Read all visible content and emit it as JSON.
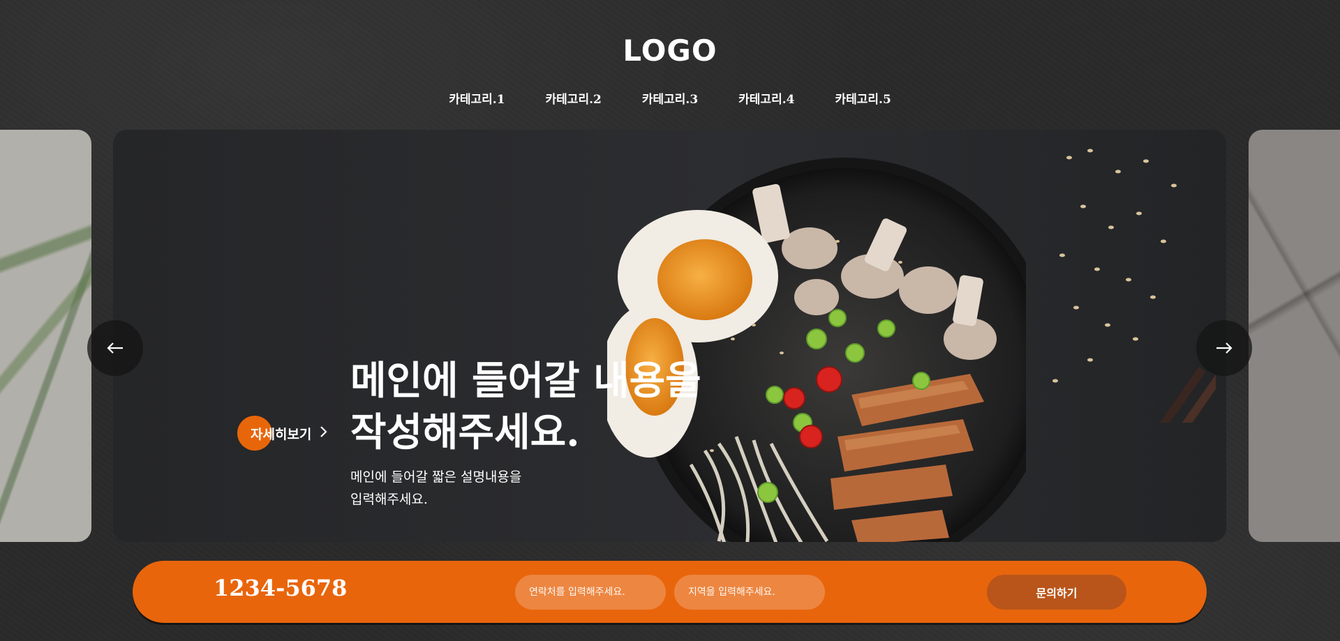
{
  "header": {
    "logo": "LOGO",
    "nav": [
      {
        "label": "카테고리.1"
      },
      {
        "label": "카테고리.2"
      },
      {
        "label": "카테고리.3"
      },
      {
        "label": "카테고리.4"
      },
      {
        "label": "카테고리.5"
      }
    ]
  },
  "hero": {
    "title_line1": "메인에 들어갈 내용을",
    "title_line2": "작성해주세요.",
    "desc_line1": "메인에 들어갈 짧은 설명내용을",
    "desc_line2": "입력해주세요.",
    "more_label": "자세히보기",
    "more_icon": "chevron-right-icon",
    "prev_icon": "arrow-left-icon",
    "next_icon": "arrow-right-icon"
  },
  "inquiry": {
    "phone": "1234-5678",
    "contact_placeholder": "연락처를 입력해주세요.",
    "region_placeholder": "지역을 입력해주세요.",
    "submit_label": "문의하기"
  },
  "colors": {
    "accent": "#e8650c",
    "background": "#2a2a2a",
    "submit": "#b9551a"
  }
}
